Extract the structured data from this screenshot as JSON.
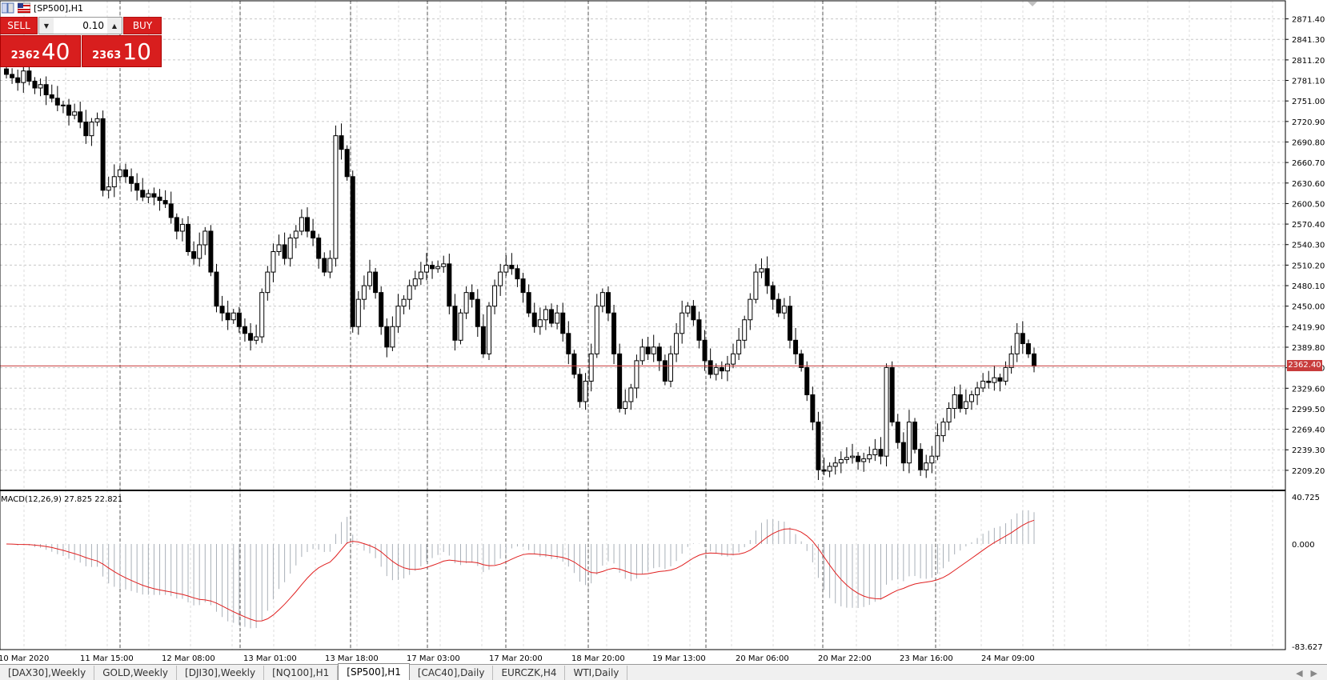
{
  "window": {
    "symbol_title": "[SP500],H1"
  },
  "trade_panel": {
    "sell_label": "SELL",
    "buy_label": "BUY",
    "volume": "0.10",
    "sell_price_small": "2362",
    "sell_price_big": "40",
    "buy_price_small": "2363",
    "buy_price_big": "10"
  },
  "price_axis": {
    "labels": [
      "2871.40",
      "2841.30",
      "2811.20",
      "2781.10",
      "2751.00",
      "2720.90",
      "2690.80",
      "2660.70",
      "2630.60",
      "2600.50",
      "2570.40",
      "2540.30",
      "2510.20",
      "2480.10",
      "2450.00",
      "2419.90",
      "2389.80",
      "2359.70",
      "2329.60",
      "2299.50",
      "2269.40",
      "2239.30",
      "2209.20"
    ],
    "current_price": "2362.40"
  },
  "macd": {
    "label": "MACD(12,26,9) 27.825 22.821",
    "axis_labels": [
      "40.725",
      "0.000",
      "-83.627"
    ]
  },
  "time_axis": {
    "labels": [
      "10 Mar 2020",
      "11 Mar 15:00",
      "12 Mar 08:00",
      "13 Mar 01:00",
      "13 Mar 18:00",
      "17 Mar 03:00",
      "17 Mar 20:00",
      "18 Mar 20:00",
      "19 Mar 13:00",
      "20 Mar 06:00",
      "20 Mar 22:00",
      "23 Mar 16:00",
      "24 Mar 09:00"
    ]
  },
  "tabs": [
    {
      "label": "[DAX30],Weekly",
      "active": false
    },
    {
      "label": "GOLD,Weekly",
      "active": false
    },
    {
      "label": "[DJI30],Weekly",
      "active": false
    },
    {
      "label": "[NQ100],H1",
      "active": false
    },
    {
      "label": "[SP500],H1",
      "active": true
    },
    {
      "label": "[CAC40],Daily",
      "active": false
    },
    {
      "label": "EURCZK,H4",
      "active": false
    },
    {
      "label": "WTI,Daily",
      "active": false
    }
  ],
  "colors": {
    "bear_candle": "#000000",
    "bull_candle": "#ffffff",
    "price_line": "#c83c3c",
    "macd_signal": "#e02020",
    "macd_hist": "#a9b0b8",
    "panel_red": "#d81e1e"
  },
  "chart_data": {
    "type": "candlestick",
    "timeframe": "H1",
    "ylim": [
      2195,
      2885
    ],
    "current_price": 2362.4,
    "closes": [
      2790,
      2785,
      2778,
      2795,
      2780,
      2770,
      2775,
      2760,
      2755,
      2745,
      2745,
      2730,
      2735,
      2720,
      2700,
      2720,
      2725,
      2620,
      2625,
      2640,
      2650,
      2640,
      2630,
      2620,
      2610,
      2615,
      2610,
      2605,
      2600,
      2580,
      2560,
      2570,
      2530,
      2520,
      2540,
      2560,
      2500,
      2450,
      2440,
      2430,
      2440,
      2420,
      2410,
      2400,
      2405,
      2470,
      2500,
      2530,
      2540,
      2520,
      2550,
      2560,
      2580,
      2560,
      2550,
      2520,
      2500,
      2520,
      2700,
      2680,
      2640,
      2420,
      2460,
      2480,
      2500,
      2470,
      2420,
      2390,
      2420,
      2450,
      2460,
      2480,
      2490,
      2500,
      2510,
      2505,
      2508,
      2512,
      2450,
      2400,
      2440,
      2470,
      2460,
      2420,
      2380,
      2450,
      2480,
      2500,
      2510,
      2505,
      2490,
      2470,
      2440,
      2420,
      2430,
      2445,
      2425,
      2440,
      2410,
      2380,
      2350,
      2310,
      2340,
      2380,
      2450,
      2470,
      2440,
      2380,
      2300,
      2310,
      2330,
      2370,
      2390,
      2380,
      2390,
      2370,
      2340,
      2380,
      2410,
      2440,
      2450,
      2430,
      2400,
      2370,
      2350,
      2360,
      2355,
      2365,
      2380,
      2400,
      2430,
      2460,
      2500,
      2505,
      2480,
      2460,
      2440,
      2450,
      2400,
      2380,
      2360,
      2320,
      2280,
      2210,
      2208,
      2215,
      2220,
      2225,
      2228,
      2230,
      2222,
      2226,
      2232,
      2240,
      2230,
      2360,
      2280,
      2250,
      2220,
      2280,
      2240,
      2210,
      2220,
      2230,
      2260,
      2280,
      2300,
      2320,
      2300,
      2310,
      2320,
      2330,
      2340,
      2338,
      2345,
      2340,
      2360,
      2380,
      2410,
      2395,
      2380,
      2362
    ]
  }
}
